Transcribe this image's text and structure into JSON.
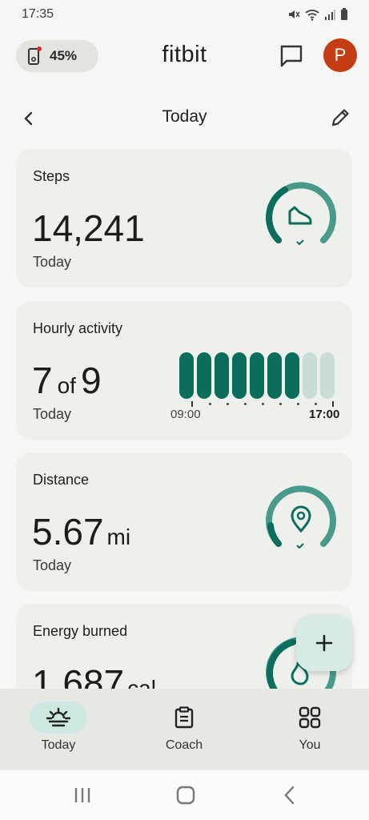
{
  "status_bar": {
    "time": "17:35",
    "icons": [
      "mute-icon",
      "wifi-icon",
      "signal-icon",
      "battery-icon"
    ]
  },
  "app_bar": {
    "device_battery": "45%",
    "brand": "fitbit",
    "avatar_initial": "P",
    "avatar_color": "#c53d12"
  },
  "sub_header": {
    "title": "Today"
  },
  "cards": {
    "steps": {
      "title": "Steps",
      "value": "14,241",
      "subtitle": "Today",
      "icon": "shoe-icon"
    },
    "hourly": {
      "title": "Hourly activity",
      "value": "7",
      "of_label": "of",
      "total": "9",
      "subtitle": "Today",
      "start_time": "09:00",
      "end_time": "17:00",
      "hours_met": [
        true,
        true,
        true,
        true,
        true,
        true,
        true,
        false,
        false
      ]
    },
    "distance": {
      "title": "Distance",
      "value": "5.67",
      "unit": "mi",
      "subtitle": "Today",
      "icon": "location-pin-icon"
    },
    "energy": {
      "title": "Energy burned",
      "value": "1,687",
      "unit": "cal",
      "icon": "flame-icon"
    }
  },
  "fab": {
    "icon": "plus-icon"
  },
  "bottom_nav": {
    "items": [
      {
        "label": "Today",
        "icon": "sunrise-icon",
        "active": true
      },
      {
        "label": "Coach",
        "icon": "clipboard-icon",
        "active": false
      },
      {
        "label": "You",
        "icon": "grid-icon",
        "active": false
      }
    ]
  },
  "colors": {
    "accent": "#0b6e5c",
    "accent_light": "#4a9a8c",
    "inactive_bar": "#c9dcd7",
    "card_bg": "#eef0ec"
  }
}
